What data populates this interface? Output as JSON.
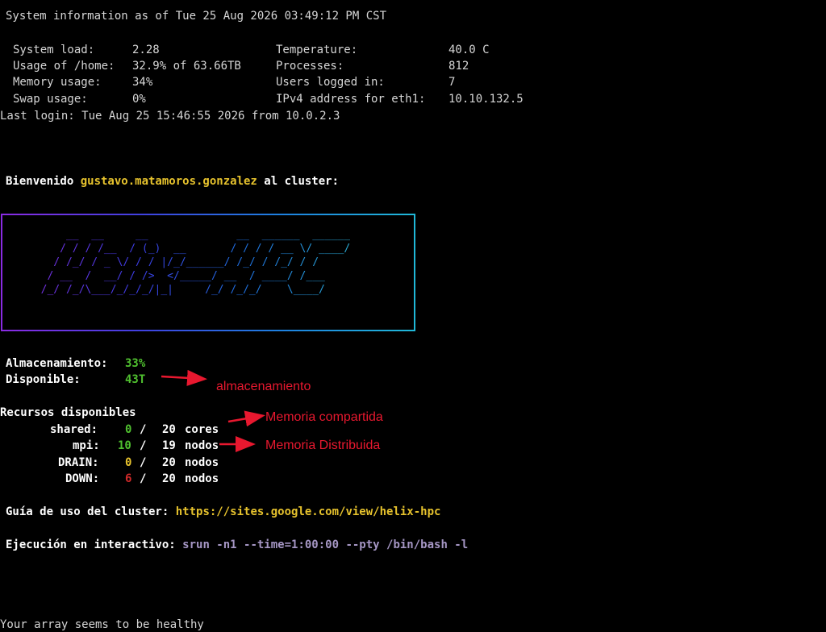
{
  "header": {
    "sysinfo": "System information as of Tue 25 Aug 2026 03:49:12 PM CST"
  },
  "stats_left": [
    {
      "label": "System load:",
      "value": "2.28"
    },
    {
      "label": "Usage of /home:",
      "value": "32.9% of 63.66TB"
    },
    {
      "label": "Memory usage:",
      "value": "34%"
    },
    {
      "label": "Swap usage:",
      "value": "0%"
    }
  ],
  "stats_right": [
    {
      "label": "Temperature:",
      "value": "40.0 C"
    },
    {
      "label": "Processes:",
      "value": "812"
    },
    {
      "label": "Users logged in:",
      "value": "7"
    },
    {
      "label": "IPv4 address for eth1:",
      "value": "10.10.132.5"
    }
  ],
  "last_login": "Last login: Tue Aug 25 15:46:55 2026 from 10.0.2.3",
  "welcome": {
    "prefix": "Bienvenido ",
    "user": "gustavo.matamoros.gonzalez",
    "suffix": " al cluster:"
  },
  "banner": {
    "art": "      __  __     __              __  ______  ______\n     / / / /__  / (_)  __       / / / / __ \\/ ____/\n    / /_/ / _ \\/ / / |/_/______/ /_/ / /_/ / /\n   / __  /  __/ / />  </_____/ __  / ____/ /___\n  /_/ /_/\\___/_/_/_/|_|     /_/ /_/_/    \\____/"
  },
  "storage": {
    "label_used": "Almacenamiento:",
    "used": "33%",
    "label_available": "Disponible:",
    "available": "43T"
  },
  "resources": {
    "title": "Recursos disponibles",
    "rows": [
      {
        "name": "shared:",
        "free": "0",
        "sep": "/",
        "total": "20",
        "unit": "cores"
      },
      {
        "name": "mpi:",
        "free": "10",
        "sep": "/",
        "total": "19",
        "unit": "nodos"
      },
      {
        "name": "DRAIN:",
        "free": "0",
        "sep": "/",
        "total": "20",
        "unit": "nodos"
      },
      {
        "name": "DOWN:",
        "free": "6",
        "sep": "/",
        "total": "20",
        "unit": "nodos"
      }
    ]
  },
  "guide": {
    "label": "Guía de uso del cluster:",
    "url": "https://sites.google.com/view/helix-hpc"
  },
  "interactive": {
    "label": "Ejecución en interactivo:",
    "command": "srun -n1 --time=1:00:00 --pty /bin/bash -l"
  },
  "footer": "Your array seems to be healthy",
  "annotations": {
    "storage": "almacenamiento",
    "shared": "Memoria compartida",
    "mpi": "Memoria Distribuida"
  },
  "colors": {
    "annotation": "#e8182f",
    "ok": "#4fbf2f",
    "down": "#d12a2a",
    "highlight": "#e6c22d"
  }
}
